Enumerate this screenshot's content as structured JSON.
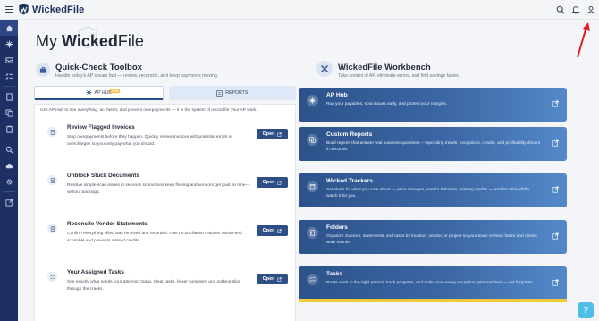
{
  "app": {
    "brand": "WickedFile"
  },
  "page": {
    "title_prefix": "My ",
    "title_emph": "Wicked",
    "title_suffix": "File"
  },
  "topbar": {
    "icons": [
      "search-icon",
      "bell-icon",
      "user-icon"
    ]
  },
  "sidebar": {
    "items": [
      "home-icon",
      "sparkle-icon",
      "inbox-icon",
      "checklist-icon",
      "document-icon",
      "copy-icon",
      "clipboard-icon",
      "search-icon",
      "cloud-upload-icon",
      "gear-icon",
      "external-link-icon"
    ]
  },
  "quick_check": {
    "title": "Quick-Check Toolbox",
    "subtitle": "Handle today's AP issues fast — review, reconcile, and keep payments moving.",
    "tabs": [
      {
        "label": "AP HUB",
        "badge": "NEW"
      },
      {
        "label": "REPORTS"
      }
    ],
    "intro": "Use AP Hub to see everything, act faster, and prevent overpayments — it is the system of record for your AP work.",
    "items": [
      {
        "title": "Review Flagged Invoices",
        "desc": "Stop overpayments before they happen. Quickly review invoices with potential errors or overcharges so you only pay what you should.",
        "button": "Open"
      },
      {
        "title": "Unblock Stuck Documents",
        "desc": "Resolve simple scan issues in seconds so invoices keep flowing and vendors get paid on time—without backlogs.",
        "button": "Open"
      },
      {
        "title": "Reconcile Vendor Statements",
        "desc": "Confirm everything billed was received and recorded. Fast reconciliation reduces month-end scramble and prevents missed credits.",
        "button": "Open"
      },
      {
        "title": "Your Assigned Tasks",
        "desc": "See exactly what needs your attention today. Clear tasks, fewer surprises, and nothing slips through the cracks.",
        "button": "Open"
      }
    ]
  },
  "workbench": {
    "title": "WickedFile Workbench",
    "subtitle": "Take control of AP, eliminate errors, and find savings faster.",
    "cards": [
      {
        "title": "AP Hub",
        "desc": "Run your payables, spot issues early, and protect your margins."
      },
      {
        "title": "Custom Reports",
        "desc": "Build reports that answer real business questions — spending trends, exceptions, credits, and profitability drivers in seconds."
      },
      {
        "title": "Wicked Trackers",
        "desc": "Set alerts for what you care about — price changes, vendor behavior, missing credits — and let WickedFile watch it for you."
      },
      {
        "title": "Folders",
        "desc": "Organize invoices, statements, and tasks by location, vendor, or project so your team reviews faster and closes work sooner."
      },
      {
        "title": "Tasks",
        "desc": "Route work to the right person, track progress, and make sure every exception gets resolved — not forgotten."
      }
    ]
  },
  "help": {
    "label": "?"
  },
  "colors": {
    "sidebar": "#1d2f63",
    "accent": "#2d4f86",
    "badge": "#f5b52e",
    "help": "#4fbfe8",
    "annotation": "#e02020"
  }
}
